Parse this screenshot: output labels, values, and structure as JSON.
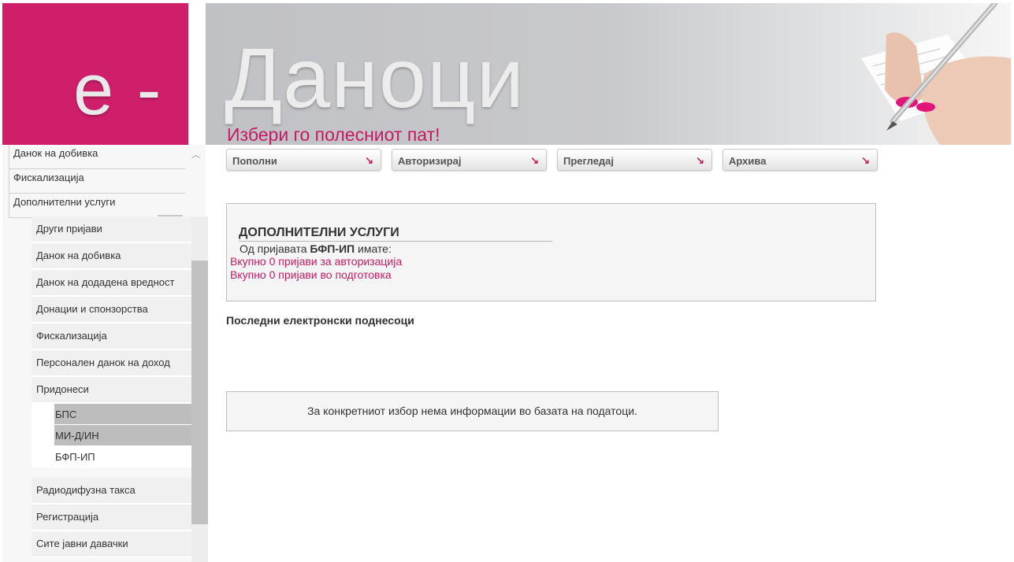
{
  "header": {
    "logo_text": "e -",
    "banner_title": "Даноци",
    "tagline": "Избери го полесниот пат!"
  },
  "sidebar": {
    "top_items": [
      {
        "label": "Данок на добивка"
      },
      {
        "label": "Фискализација"
      },
      {
        "label": "Дополнителни услуги"
      }
    ],
    "sub_items": [
      {
        "label": "Други пријави"
      },
      {
        "label": "Данок на добивка"
      },
      {
        "label": "Данок на додадена вредност"
      },
      {
        "label": "Донации и спонзорства"
      },
      {
        "label": "Фискализација"
      },
      {
        "label": "Персонален данок на доход"
      },
      {
        "label": "Придонеси"
      }
    ],
    "pridonesi_children": [
      {
        "label": "БПС"
      },
      {
        "label": "МИ-Д/ИН"
      },
      {
        "label": "БФП-ИП"
      }
    ],
    "more_items": [
      {
        "label": "Радиодифузна такса"
      },
      {
        "label": "Регистрација"
      },
      {
        "label": "Сите јавни давачки"
      }
    ]
  },
  "nav": [
    {
      "label": "Пополни"
    },
    {
      "label": "Авторизирај"
    },
    {
      "label": "Прегледај"
    },
    {
      "label": "Архива"
    }
  ],
  "nav_arrow": "↘",
  "panel": {
    "title": "ДОПОЛНИТЕЛНИ УСЛУГИ",
    "subtitle_prefix": "Од пријавата",
    "form_name": "БФП-ИП",
    "subtitle_suffix": "имате:",
    "link_authorization": "Вкупно 0 пријави за авторизација",
    "link_preparation": "Вкупно 0 пријави во подготовка"
  },
  "recent": {
    "heading": "Последни електронски поднесоци",
    "empty_message": "За конкретниот избор нема информации во базата на податоци."
  },
  "colors": {
    "brand": "#cf1f6b",
    "accent_text": "#c51a62",
    "selected_grey": "#bdbdbd"
  }
}
